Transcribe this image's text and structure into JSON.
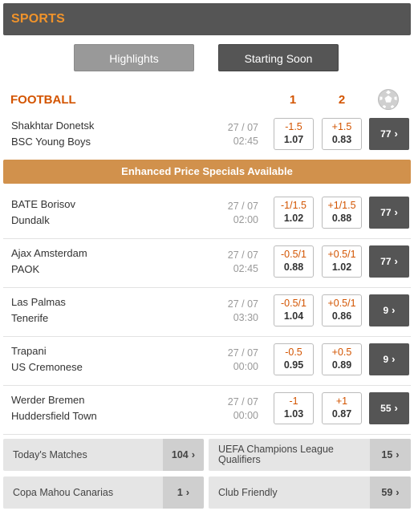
{
  "header": {
    "title": "SPORTS"
  },
  "tabs": {
    "highlights": "Highlights",
    "starting_soon": "Starting Soon"
  },
  "section": {
    "title": "FOOTBALL",
    "col1": "1",
    "col2": "2"
  },
  "promo_banner": "Enhanced Price Specials Available",
  "matches": [
    {
      "home": "Shakhtar Donetsk",
      "away": "BSC Young Boys",
      "date": "27 / 07",
      "time": "02:45",
      "odd1": {
        "handicap": "-1.5",
        "price": "1.07"
      },
      "odd2": {
        "handicap": "+1.5",
        "price": "0.83"
      },
      "more": "77"
    },
    {
      "home": "BATE Borisov",
      "away": "Dundalk",
      "date": "27 / 07",
      "time": "02:00",
      "odd1": {
        "handicap": "-1/1.5",
        "price": "1.02"
      },
      "odd2": {
        "handicap": "+1/1.5",
        "price": "0.88"
      },
      "more": "77"
    },
    {
      "home": "Ajax Amsterdam",
      "away": "PAOK",
      "date": "27 / 07",
      "time": "02:45",
      "odd1": {
        "handicap": "-0.5/1",
        "price": "0.88"
      },
      "odd2": {
        "handicap": "+0.5/1",
        "price": "1.02"
      },
      "more": "77"
    },
    {
      "home": "Las Palmas",
      "away": "Tenerife",
      "date": "27 / 07",
      "time": "03:30",
      "odd1": {
        "handicap": "-0.5/1",
        "price": "1.04"
      },
      "odd2": {
        "handicap": "+0.5/1",
        "price": "0.86"
      },
      "more": "9"
    },
    {
      "home": "Trapani",
      "away": "US Cremonese",
      "date": "27 / 07",
      "time": "00:00",
      "odd1": {
        "handicap": "-0.5",
        "price": "0.95"
      },
      "odd2": {
        "handicap": "+0.5",
        "price": "0.89"
      },
      "more": "9"
    },
    {
      "home": "Werder Bremen",
      "away": "Huddersfield Town",
      "date": "27 / 07",
      "time": "00:00",
      "odd1": {
        "handicap": "-1",
        "price": "1.03"
      },
      "odd2": {
        "handicap": "+1",
        "price": "0.87"
      },
      "more": "55"
    }
  ],
  "links": [
    {
      "label": "Today's Matches",
      "count": "104"
    },
    {
      "label": "UEFA Champions League Qualifiers",
      "count": "15"
    },
    {
      "label": "Copa Mahou Canarias",
      "count": "1"
    },
    {
      "label": "Club Friendly",
      "count": "59"
    }
  ],
  "colors": {
    "accent": "#d35400",
    "header_bg": "#555555",
    "promo_bg": "#d1914c"
  },
  "icons": {
    "sport": "soccer-ball-icon",
    "more": "chevron-right-icon"
  }
}
